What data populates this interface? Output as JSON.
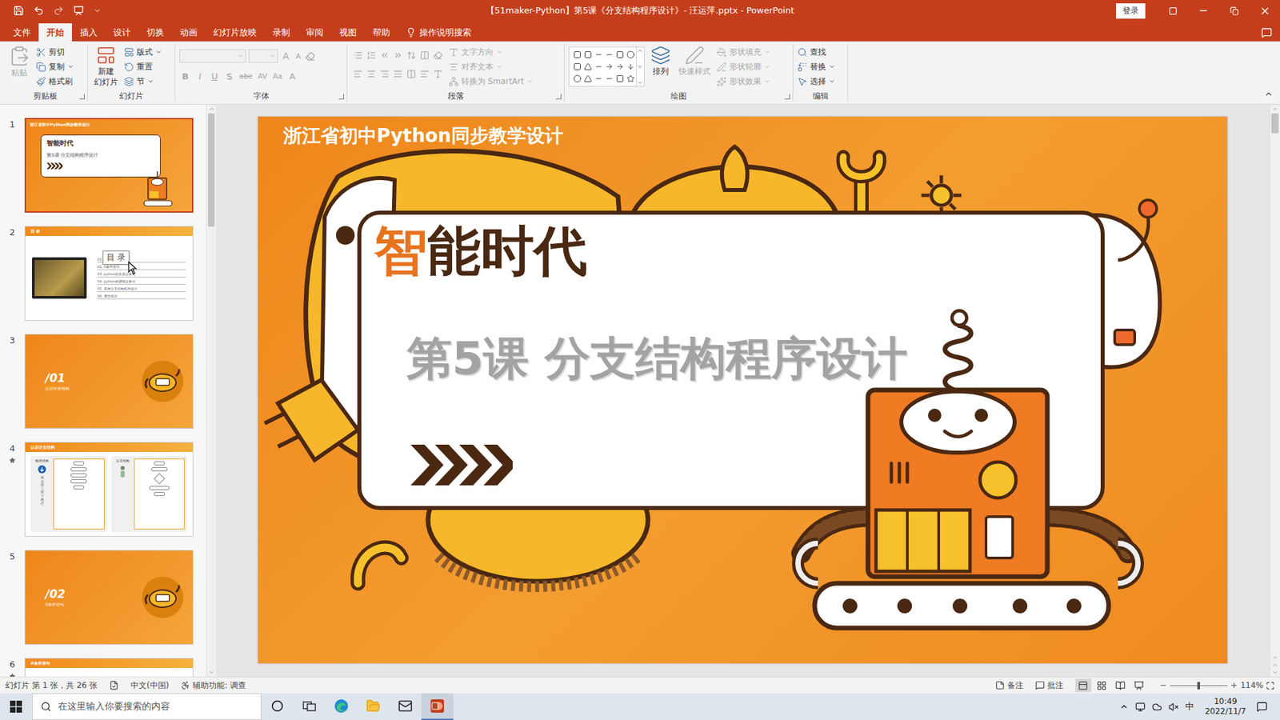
{
  "window": {
    "title": "【51maker-Python】第5课《分支结构程序设计》- 汪运萍.pptx - PowerPoint",
    "login": "登录"
  },
  "menu_tabs": [
    {
      "label": "文件",
      "selected": false,
      "kind": "tab"
    },
    {
      "label": "开始",
      "selected": true,
      "kind": "tab"
    },
    {
      "label": "插入",
      "selected": false,
      "kind": "tab"
    },
    {
      "label": "设计",
      "selected": false,
      "kind": "tab"
    },
    {
      "label": "切换",
      "selected": false,
      "kind": "tab"
    },
    {
      "label": "动画",
      "selected": false,
      "kind": "tab"
    },
    {
      "label": "幻灯片放映",
      "selected": false,
      "kind": "tab"
    },
    {
      "label": "录制",
      "selected": false,
      "kind": "tab"
    },
    {
      "label": "审阅",
      "selected": false,
      "kind": "tab"
    },
    {
      "label": "视图",
      "selected": false,
      "kind": "tab"
    },
    {
      "label": "帮助",
      "selected": false,
      "kind": "tab"
    },
    {
      "label": "操作说明搜索",
      "selected": false,
      "kind": "search"
    }
  ],
  "ribbon": {
    "clipboard": {
      "label": "剪贴板",
      "paste": {
        "label": "粘贴",
        "disabled": true
      },
      "items": [
        {
          "label": "剪切",
          "kind": "cut",
          "disabled": false,
          "dropdown": false
        },
        {
          "label": "复制",
          "kind": "copy",
          "disabled": false,
          "dropdown": true
        },
        {
          "label": "格式刷",
          "kind": "painter",
          "disabled": false,
          "dropdown": false
        }
      ]
    },
    "slides": {
      "label": "幻灯片",
      "new_slide": {
        "lines": [
          "新建",
          "幻灯片"
        ],
        "disabled": false
      },
      "items": [
        {
          "label": "版式",
          "kind": "layout",
          "disabled": false,
          "dropdown": true
        },
        {
          "label": "重置",
          "kind": "reset",
          "disabled": false,
          "dropdown": false
        },
        {
          "label": "节",
          "kind": "section",
          "disabled": false,
          "dropdown": true
        }
      ]
    },
    "font": {
      "label": "字体",
      "disabled": true,
      "size_buttons": [
        {
          "text": "A",
          "kind": "grow"
        },
        {
          "text": "A",
          "kind": "shrink"
        }
      ],
      "buttons": [
        {
          "text": "B",
          "kind": "bold"
        },
        {
          "text": "I",
          "kind": "italic"
        },
        {
          "text": "U",
          "kind": "underline"
        },
        {
          "text": "S",
          "kind": "shadow"
        },
        {
          "text": "abc",
          "kind": "strike"
        },
        {
          "text": "AV",
          "kind": "spacing"
        },
        {
          "text": "Aa",
          "kind": "case"
        },
        {
          "text": "A",
          "kind": "color"
        }
      ]
    },
    "paragraph": {
      "label": "段落",
      "disabled": true,
      "items": [
        {
          "label": "文字方向",
          "kind": "text_direction",
          "disabled": true,
          "dropdown": true
        },
        {
          "label": "对齐文本",
          "kind": "align_text",
          "disabled": true,
          "dropdown": true
        },
        {
          "label": "转换为 SmartArt",
          "kind": "smartart",
          "disabled": true,
          "dropdown": true
        }
      ]
    },
    "drawing": {
      "label": "绘图",
      "arrange": {
        "label": "排列",
        "disabled": false
      },
      "quick_styles": {
        "label": "快速样式",
        "disabled": true
      },
      "items": [
        {
          "label": "形状填充",
          "kind": "fill",
          "disabled": true,
          "dropdown": true
        },
        {
          "label": "形状轮廓",
          "kind": "outline",
          "disabled": true,
          "dropdown": true
        },
        {
          "label": "形状效果",
          "kind": "effects",
          "disabled": true,
          "dropdown": true
        }
      ]
    },
    "editing": {
      "label": "编辑",
      "items": [
        {
          "label": "查找",
          "kind": "find",
          "disabled": false,
          "dropdown": false
        },
        {
          "label": "替换",
          "kind": "replace",
          "disabled": false,
          "dropdown": true
        },
        {
          "label": "选择",
          "kind": "select",
          "disabled": false,
          "dropdown": true
        }
      ]
    }
  },
  "thumbnails": [
    {
      "number": "1",
      "starred": false,
      "selected": true,
      "kind": "title",
      "header": "浙江省初中Python同步教学设计",
      "logo": "智能时代",
      "title": "第5课 分支结构程序设计"
    },
    {
      "number": "2",
      "starred": false,
      "selected": false,
      "kind": "toc",
      "heading": "目 录",
      "items": [
        "01. 认识分支结构",
        "02. if条件语句",
        "03. python的关系运算式",
        "04. python的逻辑运算式",
        "05. 简单分支结构程序设计",
        "06. 课堂练习"
      ]
    },
    {
      "number": "3",
      "starred": false,
      "selected": false,
      "kind": "section",
      "code": "/01",
      "title": "认识分支结构"
    },
    {
      "number": "4",
      "starred": true,
      "selected": false,
      "kind": "content",
      "heading": "认识分支结构",
      "left_title": "顺序结构",
      "left_caption": "依次自上而下执行",
      "right_title": "分支结构"
    },
    {
      "number": "5",
      "starred": false,
      "selected": false,
      "kind": "section",
      "code": "/02",
      "title": "if条件语句"
    },
    {
      "number": "6",
      "starred": true,
      "selected": false,
      "kind": "partial",
      "heading": "if条件语句"
    }
  ],
  "tooltip": {
    "text": "目 录"
  },
  "slide": {
    "header": "浙江省初中Python同步教学设计",
    "logo": [
      {
        "text": "智",
        "color": "#e8731e"
      },
      {
        "text": "能时代",
        "color": "#4a2812"
      }
    ],
    "title": "第5课 分支结构程序设计"
  },
  "status_bar": {
    "slide_info": "幻灯片 第 1 张，共 26 张",
    "language": "中文(中国)",
    "accessibility": "辅助功能: 调查",
    "notes": "备注",
    "comments": "批注",
    "views": [
      {
        "kind": "normal",
        "selected": true
      },
      {
        "kind": "sorter",
        "selected": false
      },
      {
        "kind": "reading",
        "selected": false
      },
      {
        "kind": "slideshow",
        "selected": false
      }
    ],
    "zoom": "114%",
    "zoom_level": 0.5
  },
  "taskbar": {
    "search_placeholder": "在这里输入你要搜索的内容",
    "apps": [
      {
        "kind": "cortana",
        "active": false
      },
      {
        "kind": "task_view",
        "active": false
      },
      {
        "kind": "edge",
        "active": false
      },
      {
        "kind": "explorer",
        "active": false
      },
      {
        "kind": "mail",
        "active": false
      },
      {
        "kind": "powerpoint",
        "active": true
      }
    ],
    "tray": {
      "ime": "中",
      "time": "10:49",
      "date": "2022/11/7"
    }
  }
}
